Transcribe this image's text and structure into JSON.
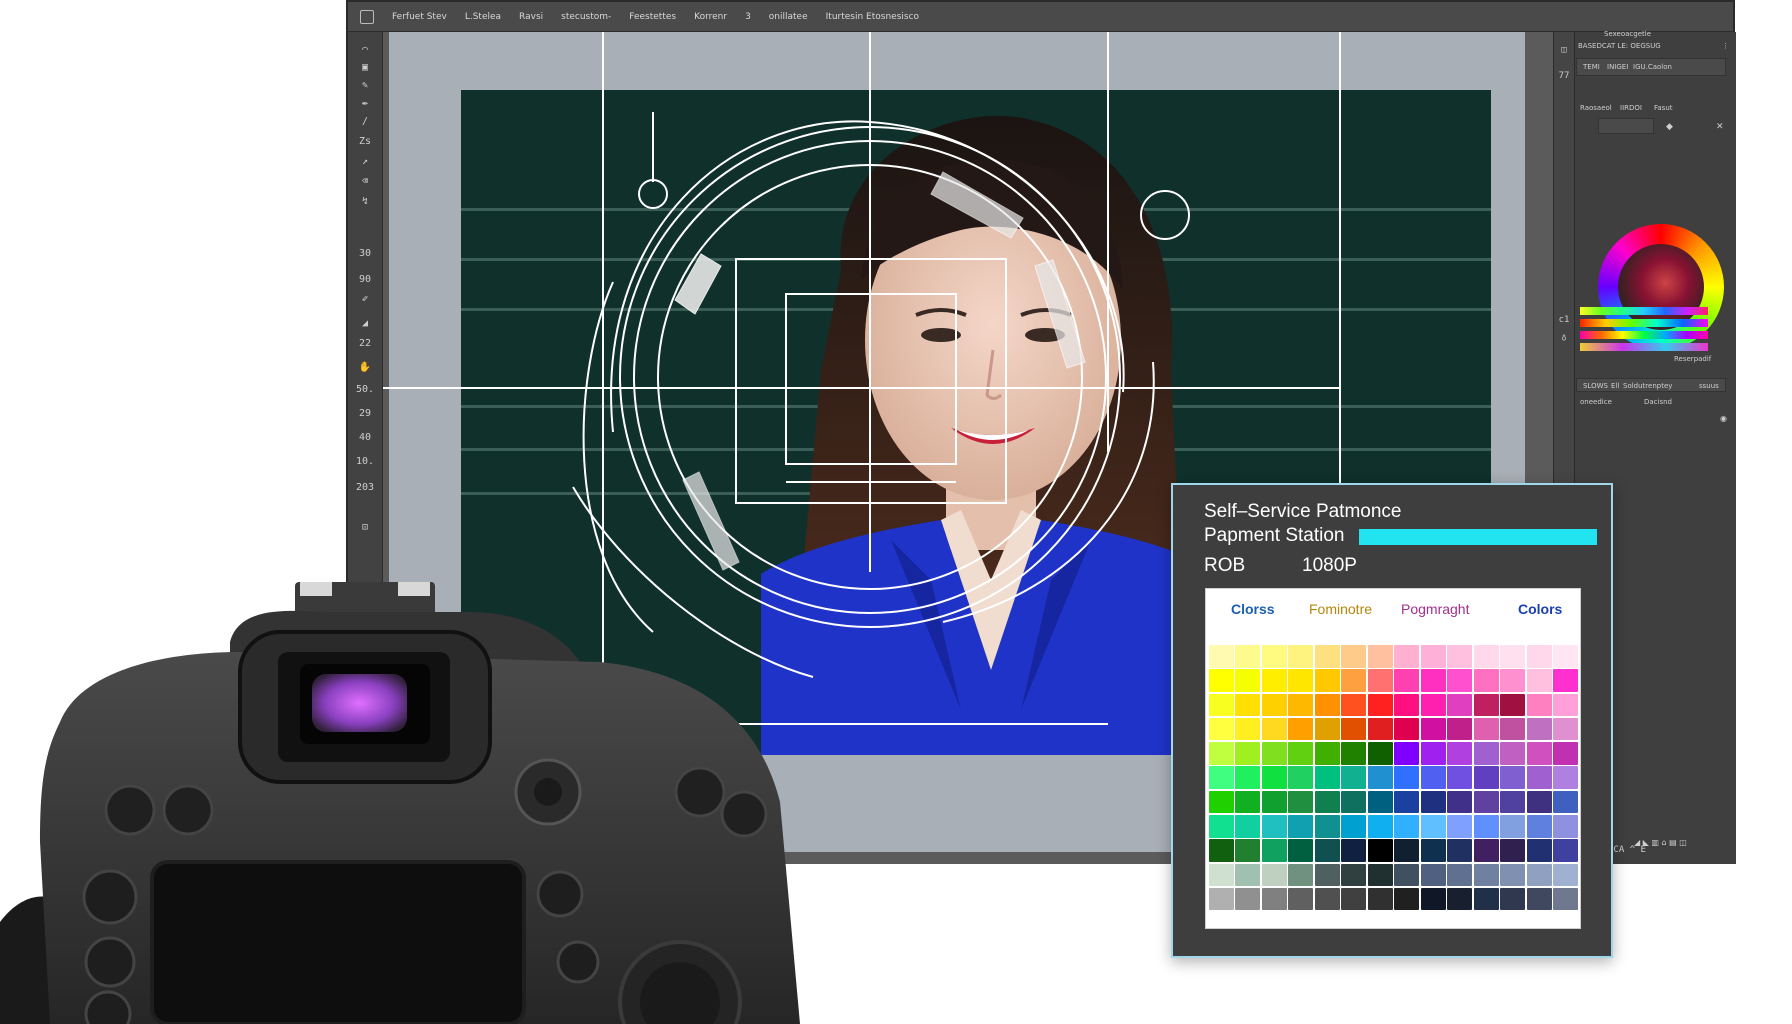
{
  "options_bar": {
    "items": [
      "Ferfuet Stev",
      "L.Stelea",
      "Ravsi",
      "stecustom-",
      "Feestettes",
      "Korrenr",
      "3",
      "onillatee",
      "Iturtesin Etosnesisco"
    ]
  },
  "toolbar": {
    "numbers": [
      "30",
      "90",
      "22",
      "50.",
      "29",
      "40",
      "10.",
      "203"
    ]
  },
  "panels": {
    "strip_labels": [
      "77",
      "c1"
    ],
    "header_top": "Sexeoacgetle",
    "tab_row": "BASEDCAT  LE: OEGSUG",
    "sub_row": [
      "TEMI",
      "INIGEI",
      "IGU.Caolon"
    ],
    "adjust_row": [
      "Raosaeol",
      "IIRDOI",
      "Fasut"
    ],
    "spectrum_label": "Reserpadif",
    "layers_row": [
      "SLOWS",
      "Ell",
      "Soldutrenptey",
      "ssuus"
    ],
    "layers_items": [
      "oneedice",
      "Dacisnd"
    ],
    "bottom_status": "ICA  ^ E"
  },
  "dialog": {
    "title": "Self–Service Patmonce",
    "subtitle": "Papment Station",
    "mode": "ROB",
    "resolution": "1080P",
    "progress_color": "#22e4f0",
    "tabs": [
      {
        "label": "Clorss",
        "color": "#1a5fb0"
      },
      {
        "label": "Fominotre",
        "color": "#b8860b"
      },
      {
        "label": "Pogmraght",
        "color": "#a0308a"
      },
      {
        "label": "Colors",
        "color": "#1a3fb0"
      }
    ],
    "swatch_rows": [
      [
        "#fffab0",
        "#fffa8c",
        "#fffb80",
        "#fff380",
        "#ffe080",
        "#ffcb8a",
        "#ffc0a0",
        "#ffb0d0",
        "#ffb0d8",
        "#ffc0e0",
        "#ffd8ec",
        "#ffe0ee",
        "#ffd8ec",
        "#ffe6f2"
      ],
      [
        "#ffff00",
        "#f6ff00",
        "#ffee00",
        "#ffe600",
        "#ffc800",
        "#ffa040",
        "#ff7070",
        "#ff40b0",
        "#ff30c0",
        "#ff50d0",
        "#ff70c0",
        "#ff90d0",
        "#ffc0e0",
        "#ff30d0"
      ],
      [
        "#f8ff20",
        "#ffe000",
        "#ffd000",
        "#ffb800",
        "#ff9000",
        "#ff5020",
        "#ff2020",
        "#ff1080",
        "#ff20b0",
        "#e040c0",
        "#c02060",
        "#a01040",
        "#ff80c0",
        "#ffa0d8"
      ],
      [
        "#ffff40",
        "#ffee20",
        "#ffd820",
        "#ff9f00",
        "#e0a000",
        "#e05000",
        "#e02020",
        "#e00050",
        "#d010a0",
        "#c0208a",
        "#e060b0",
        "#c050a0",
        "#c070c0",
        "#e090d0"
      ],
      [
        "#c0ff40",
        "#a0f020",
        "#80e020",
        "#60d010",
        "#40b000",
        "#208000",
        "#106000",
        "#8000ff",
        "#a020f0",
        "#b040e0",
        "#a060d0",
        "#c060c0",
        "#d050c0",
        "#c030b0"
      ],
      [
        "#40ff80",
        "#20f060",
        "#10e040",
        "#20d060",
        "#00c080",
        "#10b090",
        "#2090d0",
        "#3070ff",
        "#5060f0",
        "#7050e0",
        "#6040c0",
        "#8060d0",
        "#a060d0",
        "#b080e0"
      ],
      [
        "#20d000",
        "#10b020",
        "#10a030",
        "#209040",
        "#108050",
        "#107060",
        "#006080",
        "#1a40a0",
        "#203080",
        "#40308a",
        "#6040a0",
        "#5040a0",
        "#403080",
        "#4060c0"
      ],
      [
        "#10e090",
        "#10d0a0",
        "#20c0c0",
        "#10a0b0",
        "#109090",
        "#00a0d0",
        "#10b0f0",
        "#30b0ff",
        "#60c0ff",
        "#80a0ff",
        "#6090ff",
        "#80a0e0",
        "#6080e0",
        "#9090e0"
      ],
      [
        "#106010",
        "#208030",
        "#10a060",
        "#006040",
        "#105050",
        "#102040",
        "#000000",
        "#102030",
        "#103050",
        "#203060",
        "#402060",
        "#302050",
        "#203070",
        "#4040a0"
      ],
      [
        "#d0e0d0",
        "#a0c0b0",
        "#c0d0c0",
        "#709080",
        "#506060",
        "#304040",
        "#203030",
        "#405060",
        "#506080",
        "#607090",
        "#7080a0",
        "#8090b0",
        "#90a0c0",
        "#a0b0d0"
      ],
      [
        "#b0b0b0",
        "#909090",
        "#808080",
        "#606060",
        "#505050",
        "#404040",
        "#303030",
        "#202020",
        "#101828",
        "#182030",
        "#203048",
        "#303850",
        "#404860",
        "#707890"
      ]
    ]
  }
}
